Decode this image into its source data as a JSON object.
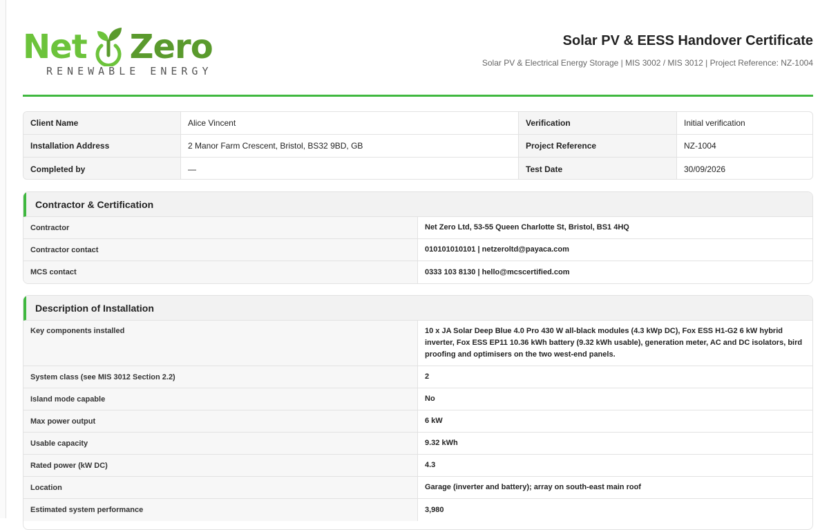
{
  "logo": {
    "word1": "Net",
    "word2": "Zero",
    "tagline": "RENEWABLE ENERGY"
  },
  "header": {
    "title": "Solar PV & EESS Handover Certificate",
    "subtitle": "Solar PV & Electrical Energy Storage | MIS 3002 / MIS 3012 | Project Reference: NZ-1004"
  },
  "info": {
    "rows": [
      {
        "k1": "Client Name",
        "v1": "Alice Vincent",
        "k2": "Verification",
        "v2": "Initial verification"
      },
      {
        "k1": "Installation Address",
        "v1": "2 Manor Farm Crescent, Bristol, BS32 9BD, GB",
        "k2": "Project Reference",
        "v2": "NZ-1004"
      },
      {
        "k1": "Completed by",
        "v1": "—",
        "k2": "Test Date",
        "v2": "30/09/2026"
      }
    ]
  },
  "contractor": {
    "heading": "Contractor & Certification",
    "rows": [
      {
        "k": "Contractor",
        "v": "Net Zero Ltd, 53-55 Queen Charlotte St, Bristol, BS1 4HQ"
      },
      {
        "k": "Contractor contact",
        "v": "010101010101 | netzeroltd@payaca.com"
      },
      {
        "k": "MCS contact",
        "v": "0333 103 8130 | hello@mcscertified.com"
      }
    ]
  },
  "description": {
    "heading": "Description of Installation",
    "rows": [
      {
        "k": "Key components installed",
        "v": "10 x JA Solar Deep Blue 4.0 Pro 430 W all-black modules (4.3 kWp DC), Fox ESS H1-G2 6 kW hybrid inverter, Fox ESS EP11 10.36 kWh battery (9.32 kWh usable), generation meter, AC and DC isolators, bird proofing and optimisers on the two west-end panels."
      },
      {
        "k": "System class (see MIS 3012 Section 2.2)",
        "v": "2"
      },
      {
        "k": "Island mode capable",
        "v": "No"
      },
      {
        "k": "Max power output",
        "v": "6 kW"
      },
      {
        "k": "Usable capacity",
        "v": "9.32 kWh"
      },
      {
        "k": "Rated power (kW DC)",
        "v": "4.3"
      },
      {
        "k": "Location",
        "v": "Garage (inverter and battery); array on south-east main roof"
      },
      {
        "k": "Estimated system performance",
        "v": "3,980"
      }
    ]
  },
  "colors": {
    "accent": "#3fb83f",
    "logo_light": "#6cc33b",
    "logo_dark": "#5a9a2d"
  },
  "icons": {
    "logo_mark": "power-leaf-icon"
  }
}
